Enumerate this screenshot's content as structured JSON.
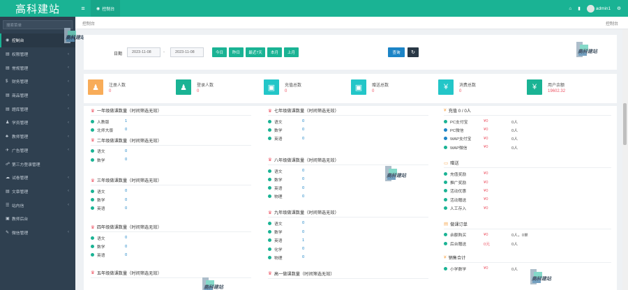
{
  "app": {
    "logo": "高科建站",
    "search_placeholder": "搜索菜单"
  },
  "sidebar": {
    "items": [
      {
        "icon": "◉",
        "label": "控制台",
        "active": true,
        "arrow": ""
      },
      {
        "icon": "▤",
        "label": "权限管理",
        "arrow": "‹"
      },
      {
        "icon": "▤",
        "label": "常规管理",
        "arrow": "‹"
      },
      {
        "icon": "$",
        "label": "财务管理",
        "arrow": "‹"
      },
      {
        "icon": "▤",
        "label": "商品管理",
        "arrow": "‹"
      },
      {
        "icon": "▤",
        "label": "题库管理",
        "arrow": "‹"
      },
      {
        "icon": "♟",
        "label": "学员管理",
        "arrow": "‹"
      },
      {
        "icon": "♣",
        "label": "教师管理",
        "arrow": "‹"
      },
      {
        "icon": "✈",
        "label": "广告管理",
        "arrow": "‹"
      },
      {
        "icon": "☍",
        "label": "第三方登录管理",
        "arrow": ""
      },
      {
        "icon": "☁",
        "label": "试卷管理",
        "arrow": "‹"
      },
      {
        "icon": "▤",
        "label": "文章管理",
        "arrow": "‹"
      },
      {
        "icon": "☰",
        "label": "站内信",
        "arrow": "‹"
      },
      {
        "icon": "▣",
        "label": "教师后台",
        "arrow": ""
      },
      {
        "icon": "✎",
        "label": "微信管理",
        "arrow": "‹"
      }
    ]
  },
  "topbar": {
    "menu_icon": "≡",
    "tab_icon": "◉",
    "tab_label": "控制台",
    "home_icon": "⌂",
    "trash_icon": "▮",
    "user": "admin1",
    "gear_icon": "⚙"
  },
  "breadcrumb": {
    "left": "控制台",
    "right": "控制台"
  },
  "filter": {
    "date_label": "日期",
    "date_start": "2023-11-08",
    "date_end": "2023-11-08",
    "dash": "-",
    "quick": [
      "今日",
      "昨日",
      "最近7天",
      "本月",
      "上月"
    ],
    "search": "查询",
    "refresh_icon": "↻"
  },
  "watermark": "高科建站",
  "stats": [
    {
      "icon": "♟",
      "color": "#f8ac59",
      "label": "注册人数",
      "value": "0"
    },
    {
      "icon": "♟",
      "color": "#1ab394",
      "label": "登录人数",
      "value": "0"
    },
    {
      "icon": "▣",
      "color": "#23c6c8",
      "label": "充值总数",
      "value": "0"
    },
    {
      "icon": "▣",
      "color": "#23c6c8",
      "label": "赠送总数",
      "value": "0"
    },
    {
      "icon": "¥",
      "color": "#23c6c8",
      "label": "消费总数",
      "value": "0"
    },
    {
      "icon": "¥",
      "color": "#1ab394",
      "label": "用户余额",
      "value": "19602.32"
    }
  ],
  "col1": [
    {
      "title": "一年级做课数量（时间筛选无效）",
      "rows": [
        {
          "name": "人教版",
          "value": "1"
        },
        {
          "name": "北师大版",
          "value": "0"
        }
      ]
    },
    {
      "title": "二年级做课数量（时间筛选无效）",
      "rows": [
        {
          "name": "语文",
          "value": "0"
        },
        {
          "name": "数学",
          "value": "0"
        }
      ]
    },
    {
      "title": "三年级做课数量（时间筛选无效）",
      "rows": [
        {
          "name": "语文",
          "value": "0"
        },
        {
          "name": "数学",
          "value": "0"
        },
        {
          "name": "英语",
          "value": "0"
        }
      ]
    },
    {
      "title": "四年级做课数量（时间筛选无效）",
      "rows": [
        {
          "name": "语文",
          "value": "0"
        },
        {
          "name": "数学",
          "value": "0"
        },
        {
          "name": "英语",
          "value": "0"
        }
      ]
    },
    {
      "title": "五年级做课数量（时间筛选无效）",
      "rows": []
    }
  ],
  "col2": [
    {
      "title": "七年级做课数量（时间筛选无效）",
      "rows": [
        {
          "name": "语文",
          "value": "0"
        },
        {
          "name": "数学",
          "value": "0"
        },
        {
          "name": "英语",
          "value": "0"
        }
      ]
    },
    {
      "title": "八年级做课数量（时间筛选无效）",
      "rows": [
        {
          "name": "语文",
          "value": "0"
        },
        {
          "name": "数学",
          "value": "0"
        },
        {
          "name": "英语",
          "value": "0"
        },
        {
          "name": "物理",
          "value": "0"
        }
      ]
    },
    {
      "title": "九年级做课数量（时间筛选无效）",
      "rows": [
        {
          "name": "语文",
          "value": "0"
        },
        {
          "name": "数学",
          "value": "0"
        },
        {
          "name": "英语",
          "value": "1"
        },
        {
          "name": "化学",
          "value": "0"
        },
        {
          "name": "物理",
          "value": "0"
        }
      ]
    },
    {
      "title": "高一做课数量（时间筛选无效）",
      "rows": []
    }
  ],
  "col3": [
    {
      "title": "充值 0 / 0人",
      "icon": "¥",
      "rows": [
        {
          "dot": "#1ab394",
          "name": "PC支付宝",
          "money": "¥0",
          "count": "0人"
        },
        {
          "dot": "#1c84c6",
          "name": "PC微信",
          "money": "¥0",
          "count": "0人"
        },
        {
          "dot": "#1c84c6",
          "name": "WAP支付宝",
          "money": "¥0",
          "count": "0人"
        },
        {
          "dot": "#1ab394",
          "name": "WAP微信",
          "money": "¥0",
          "count": "0人"
        }
      ]
    },
    {
      "title": "赠送",
      "icon": "▭",
      "rows": [
        {
          "dot": "#1ab394",
          "name": "充值奖励",
          "money": "¥0",
          "count": ""
        },
        {
          "dot": "#1ab394",
          "name": "推广奖励",
          "money": "¥0",
          "count": ""
        },
        {
          "dot": "#1ab394",
          "name": "活动优惠",
          "money": "¥0",
          "count": ""
        },
        {
          "dot": "#1ab394",
          "name": "活动赠送",
          "money": "¥0",
          "count": ""
        },
        {
          "dot": "#1ab394",
          "name": "人工存入",
          "money": "¥0",
          "count": ""
        }
      ]
    },
    {
      "title": "做课订单",
      "icon": "▤",
      "rows": [
        {
          "dot": "#1ab394",
          "name": "余额购买",
          "money": "¥0",
          "count": "0人，0单"
        },
        {
          "dot": "#1ab394",
          "name": "后台赠送",
          "money": "0元",
          "count": "0人"
        }
      ]
    },
    {
      "title": "销售合计",
      "icon": "¥",
      "rows": [
        {
          "dot": "#1ab394",
          "name": "小学数学",
          "money": "¥0",
          "count": "0人"
        }
      ]
    }
  ]
}
